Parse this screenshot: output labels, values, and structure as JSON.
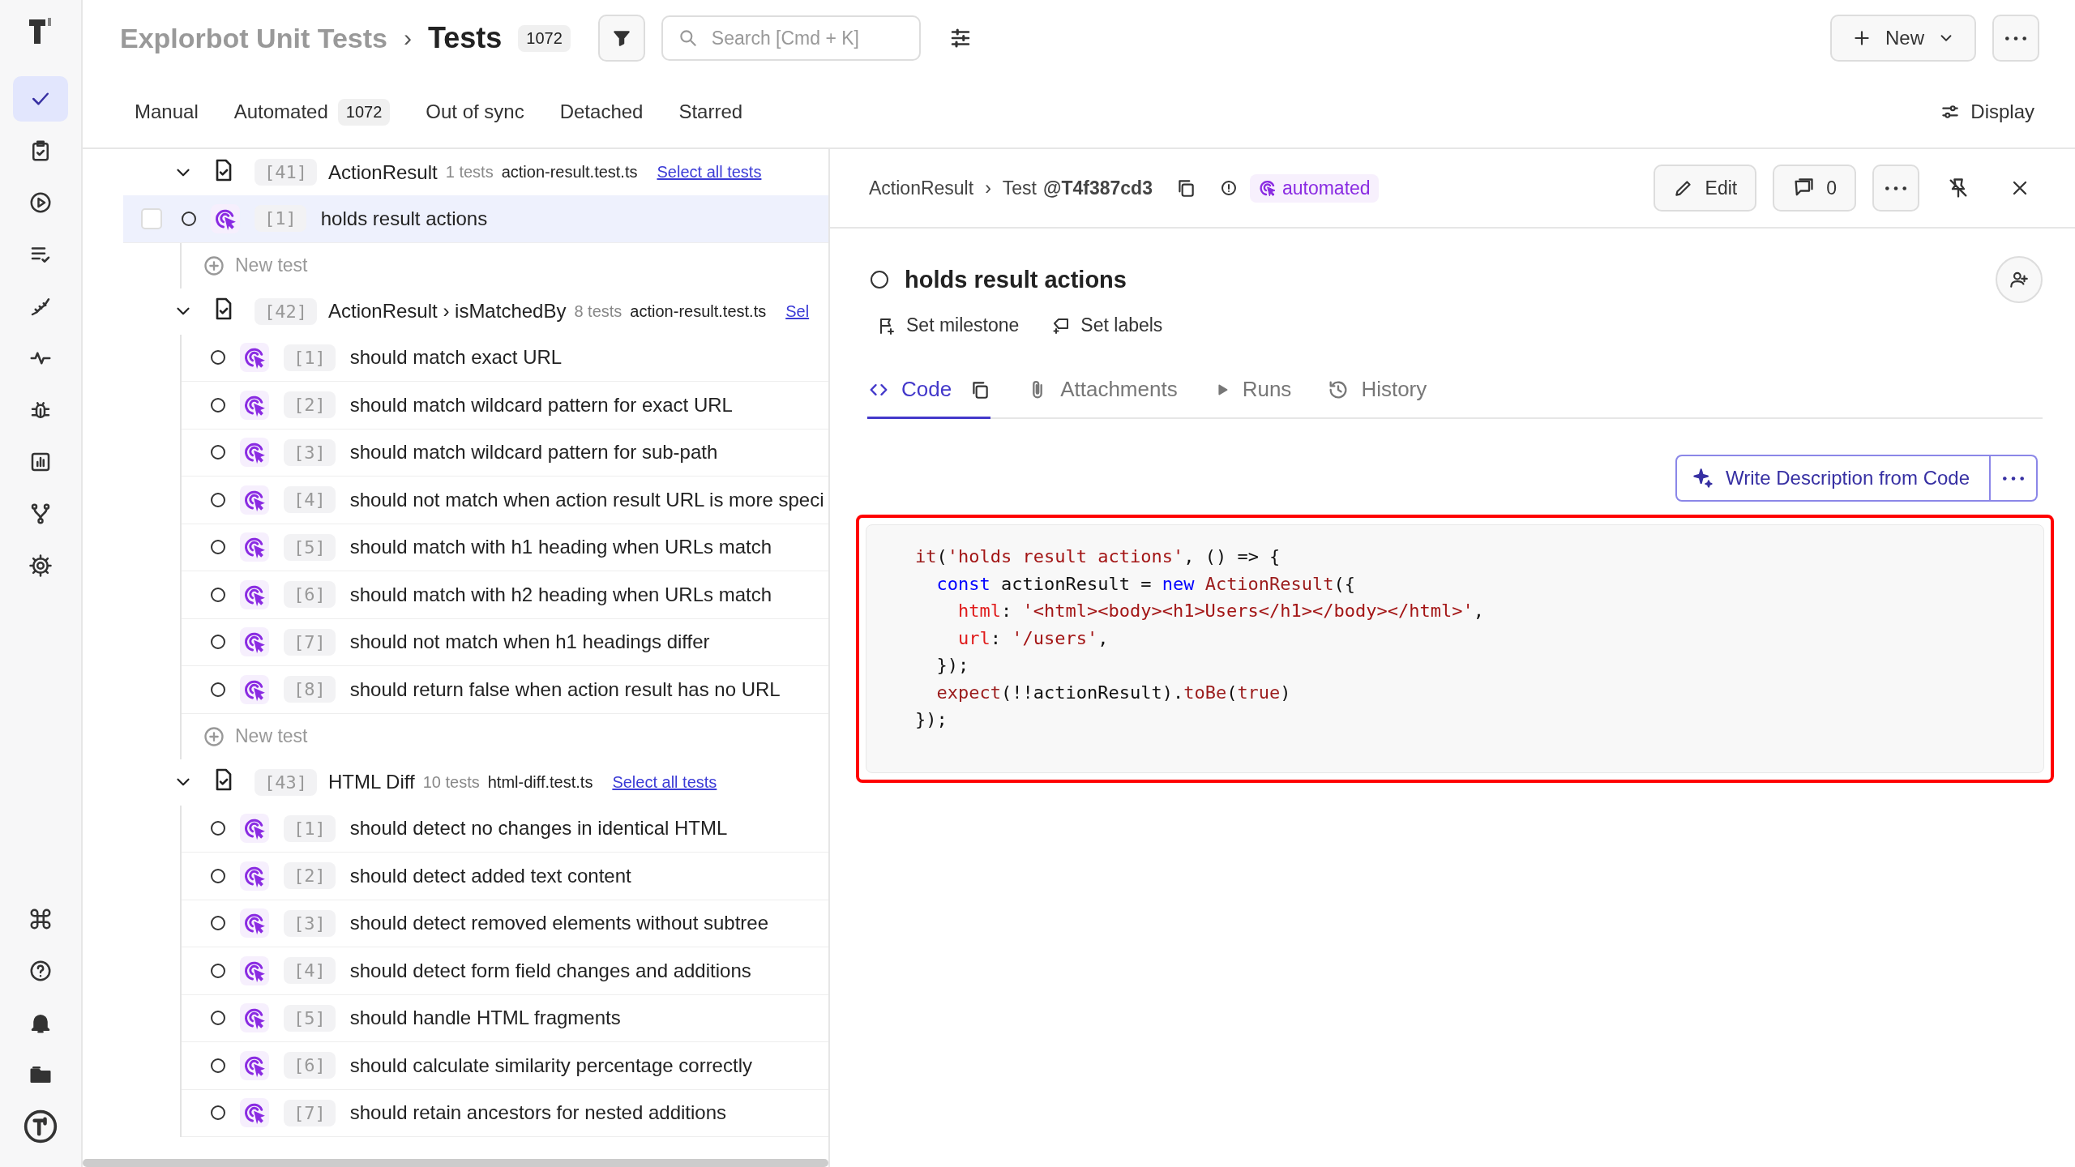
{
  "sidebar": {
    "items": [
      {
        "selected": true
      },
      {
        "selected": false
      },
      {
        "selected": false
      },
      {
        "selected": false
      },
      {
        "selected": false
      },
      {
        "selected": false
      },
      {
        "selected": false
      },
      {
        "selected": false
      },
      {
        "selected": false
      },
      {
        "selected": false
      }
    ]
  },
  "header": {
    "breadcrumb": "Explorbot Unit Tests",
    "separator": "›",
    "title": "Tests",
    "count": "1072",
    "search": {
      "placeholder": "Search [Cmd + K]"
    },
    "new_button": "New"
  },
  "tabs": [
    {
      "label": "Manual"
    },
    {
      "label": "Automated",
      "count": "1072"
    },
    {
      "label": "Out of sync"
    },
    {
      "label": "Detached"
    },
    {
      "label": "Starred"
    }
  ],
  "display_button": "Display",
  "suites": [
    {
      "number": "[41]",
      "title": "ActionResult",
      "count": "1 tests",
      "file": "action-result.test.ts",
      "select_all": "Select all tests",
      "expanded": true,
      "new_test": "New test",
      "tests": [
        {
          "number": "[1]",
          "title": "holds result actions",
          "selected": true
        }
      ]
    },
    {
      "number": "[42]",
      "title": "ActionResult › isMatchedBy",
      "count": "8 tests",
      "file": "action-result.test.ts",
      "select_all": "Sel",
      "expanded": true,
      "new_test": "New test",
      "tests": [
        {
          "number": "[1]",
          "title": "should match exact URL",
          "selected": false
        },
        {
          "number": "[2]",
          "title": "should match wildcard pattern for exact URL",
          "selected": false
        },
        {
          "number": "[3]",
          "title": "should match wildcard pattern for sub-path",
          "selected": false
        },
        {
          "number": "[4]",
          "title": "should not match when action result URL is more speci",
          "selected": false
        },
        {
          "number": "[5]",
          "title": "should match with h1 heading when URLs match",
          "selected": false
        },
        {
          "number": "[6]",
          "title": "should match with h2 heading when URLs match",
          "selected": false
        },
        {
          "number": "[7]",
          "title": "should not match when h1 headings differ",
          "selected": false
        },
        {
          "number": "[8]",
          "title": "should return false when action result has no URL",
          "selected": false
        }
      ]
    },
    {
      "number": "[43]",
      "title": "HTML Diff",
      "count": "10 tests",
      "file": "html-diff.test.ts",
      "select_all": "Select all tests",
      "expanded": true,
      "tests": [
        {
          "number": "[1]",
          "title": "should detect no changes in identical HTML",
          "selected": false
        },
        {
          "number": "[2]",
          "title": "should detect added text content",
          "selected": false
        },
        {
          "number": "[3]",
          "title": "should detect removed elements without subtree",
          "selected": false
        },
        {
          "number": "[4]",
          "title": "should detect form field changes and additions",
          "selected": false
        },
        {
          "number": "[5]",
          "title": "should handle HTML fragments",
          "selected": false
        },
        {
          "number": "[6]",
          "title": "should calculate similarity percentage correctly",
          "selected": false
        },
        {
          "number": "[7]",
          "title": "should retain ancestors for nested additions",
          "selected": false
        }
      ]
    }
  ],
  "detail": {
    "breadcrumb": "ActionResult",
    "separator": "›",
    "test_label": "Test",
    "test_id": "@T4f387cd3",
    "badge": "automated",
    "edit_button": "Edit",
    "comments": "0",
    "title": "holds result actions",
    "set_milestone": "Set milestone",
    "set_labels": "Set labels",
    "tabs": [
      {
        "label": "Code",
        "selected": true
      },
      {
        "label": "Attachments",
        "selected": false
      },
      {
        "label": "Runs",
        "selected": false
      },
      {
        "label": "History",
        "selected": false
      }
    ],
    "write_button": "Write Description from Code",
    "code": {
      "highlighted": true,
      "lines": [
        {
          "tokens": [
            {
              "kind": "fn",
              "text": "it"
            },
            {
              "kind": "plain",
              "text": "("
            },
            {
              "kind": "str",
              "text": "'holds result actions'"
            },
            {
              "kind": "plain",
              "text": ", () => {"
            }
          ],
          "children": [
            {
              "tokens": [
                {
                  "kind": "kw",
                  "text": "const"
                },
                {
                  "kind": "plain",
                  "text": " actionResult = "
                },
                {
                  "kind": "kw",
                  "text": "new"
                },
                {
                  "kind": "fn",
                  "text": " ActionResult"
                },
                {
                  "kind": "plain",
                  "text": "({"
                }
              ],
              "children": [
                {
                  "tokens": [
                    {
                      "kind": "prop",
                      "text": "html"
                    },
                    {
                      "kind": "plain",
                      "text": ": "
                    },
                    {
                      "kind": "str",
                      "text": "'<html><body><h1>Users</h1></body></html>'"
                    },
                    {
                      "kind": "plain",
                      "text": ","
                    }
                  ]
                },
                {
                  "tokens": [
                    {
                      "kind": "prop",
                      "text": "url"
                    },
                    {
                      "kind": "plain",
                      "text": ": "
                    },
                    {
                      "kind": "str",
                      "text": "'/users'"
                    },
                    {
                      "kind": "plain",
                      "text": ","
                    }
                  ]
                }
              ]
            },
            {
              "tokens": [
                {
                  "kind": "plain",
                  "text": "});"
                }
              ]
            },
            {
              "tokens": [
                {
                  "kind": "fn",
                  "text": "expect"
                },
                {
                  "kind": "plain",
                  "text": "(!!actionResult)."
                },
                {
                  "kind": "fn",
                  "text": "toBe"
                },
                {
                  "kind": "plain",
                  "text": "("
                },
                {
                  "kind": "fn",
                  "text": "true"
                },
                {
                  "kind": "plain",
                  "text": ")"
                }
              ]
            }
          ]
        },
        {
          "tokens": [
            {
              "kind": "plain",
              "text": "});"
            }
          ]
        }
      ]
    }
  }
}
